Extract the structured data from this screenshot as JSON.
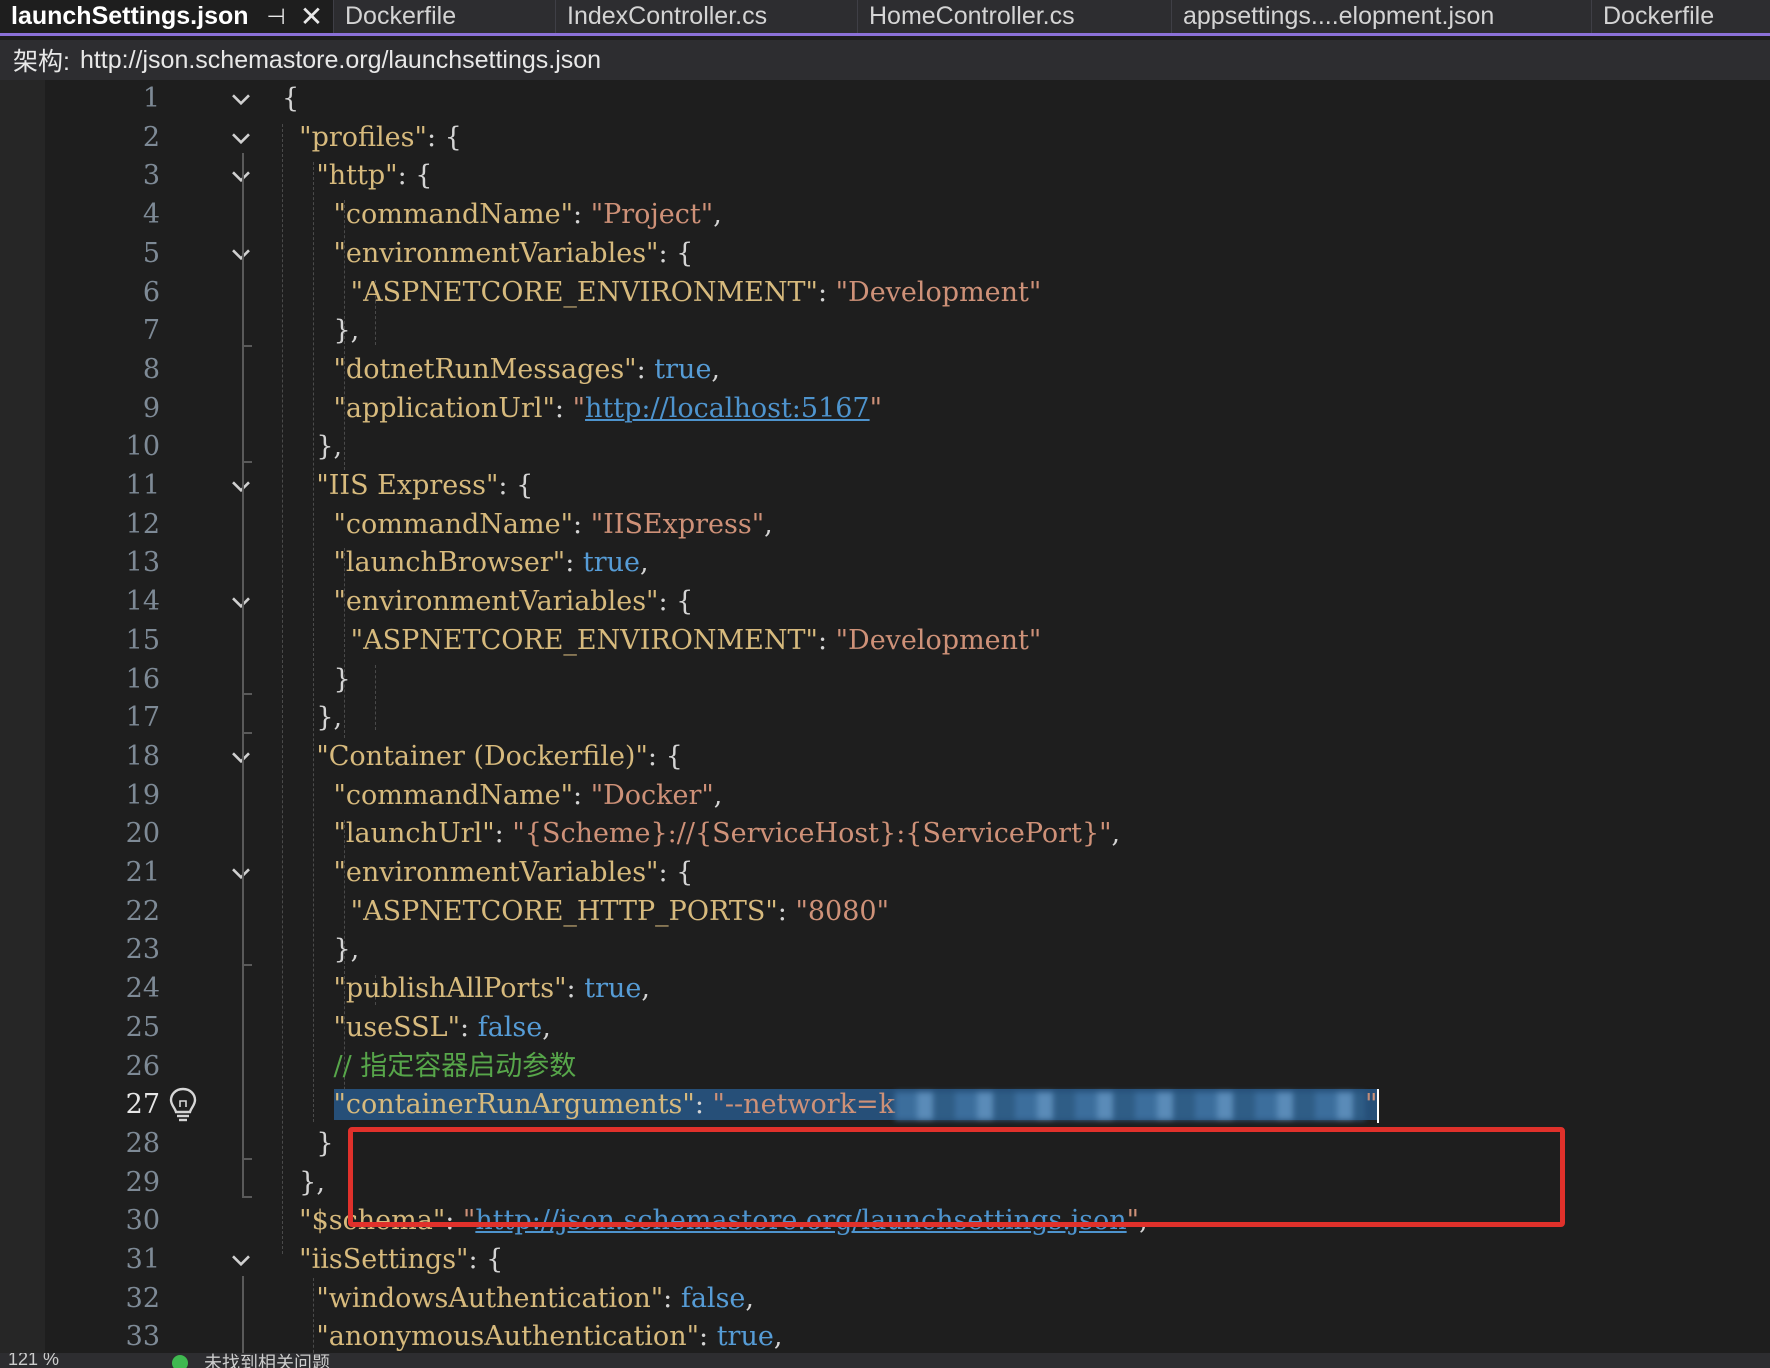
{
  "tabs": [
    {
      "label": "launchSettings.json",
      "active": true
    },
    {
      "label": "Dockerfile"
    },
    {
      "label": "IndexController.cs"
    },
    {
      "label": "HomeController.cs"
    },
    {
      "label": "appsettings....elopment.json"
    },
    {
      "label": "Dockerfile"
    }
  ],
  "schema_bar": {
    "label": "架构:",
    "url": "http://json.schemastore.org/launchsettings.json"
  },
  "editor": {
    "current_line": 27,
    "line_numbers": [
      "1",
      "2",
      "3",
      "4",
      "5",
      "6",
      "7",
      "8",
      "9",
      "10",
      "11",
      "12",
      "13",
      "14",
      "15",
      "16",
      "17",
      "18",
      "19",
      "20",
      "21",
      "22",
      "23",
      "24",
      "25",
      "26",
      "27",
      "28",
      "29",
      "30",
      "31",
      "32",
      "33"
    ],
    "code": {
      "l1_brace": "{",
      "profiles_key": "\"profiles\"",
      "http_key": "\"http\"",
      "commandName_key": "\"commandName\"",
      "project_val": "\"Project\"",
      "envVars_key": "\"environmentVariables\"",
      "aspnetcore_env_key": "\"ASPNETCORE_ENVIRONMENT\"",
      "development_val": "\"Development\"",
      "dotnetRunMessages_key": "\"dotnetRunMessages\"",
      "true_val": "true",
      "false_val": "false",
      "applicationUrl_key": "\"applicationUrl\"",
      "localhost_url": "http://localhost:5167",
      "iis_express_key": "\"IIS Express\"",
      "iisexpress_val": "\"IISExpress\"",
      "launchBrowser_key": "\"launchBrowser\"",
      "container_key": "\"Container (Dockerfile)\"",
      "docker_val": "\"Docker\"",
      "launchUrl_key": "\"launchUrl\"",
      "launchUrl_val": "\"{Scheme}://{ServiceHost}:{ServicePort}\"",
      "http_ports_key": "\"ASPNETCORE_HTTP_PORTS\"",
      "port_val": "\"8080\"",
      "publishAllPorts_key": "\"publishAllPorts\"",
      "useSSL_key": "\"useSSL\"",
      "comment": "// 指定容器启动参数",
      "containerRunArguments_key": "\"containerRunArguments\"",
      "network_val_visible": "\"--network=k",
      "schema_key": "\"$schema\"",
      "schema_url": "http://json.schemastore.org/launchsettings.json",
      "iisSettings_key": "\"iisSettings\"",
      "windowsAuth_key": "\"windowsAuthentication\"",
      "anonymousAuth_key": "\"anonymousAuthentication\""
    }
  },
  "status": {
    "zoom": "121 %",
    "text": "未找到相关问题"
  },
  "colors": {
    "key": "#d7ba7d",
    "string": "#ce9178",
    "keyword": "#569cd6",
    "comment": "#57a64a",
    "link": "#4e94ce",
    "selection": "#264f78",
    "highlight_box": "#e0312b",
    "tab_accent": "#8b71d8"
  }
}
